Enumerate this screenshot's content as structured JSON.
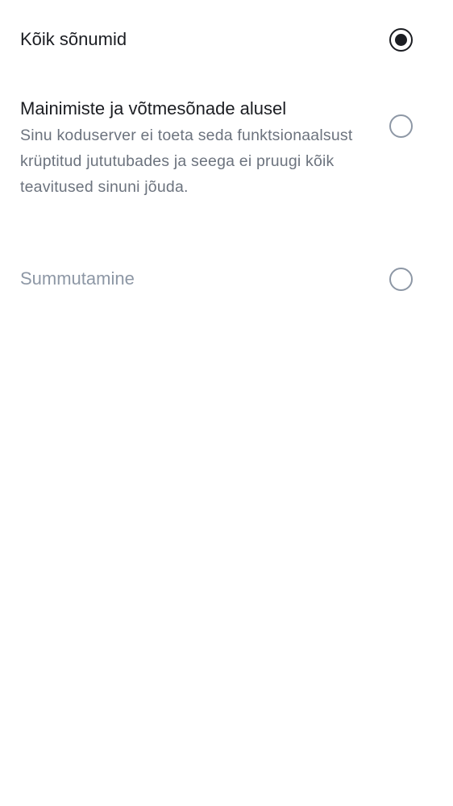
{
  "notification_options": {
    "all_messages": {
      "label": "Kõik sõnumid",
      "selected": true
    },
    "mentions_keywords": {
      "label": "Mainimiste ja võtmesõnade alusel",
      "description": "Sinu koduserver ei toeta seda funktsionaalsust krüptitud jututubades ja seega ei pruugi kõik teavitused sinuni jõuda.",
      "selected": false
    },
    "mute": {
      "label": "Summutamine",
      "selected": false,
      "disabled": true
    }
  },
  "colors": {
    "text_primary": "#1b1d22",
    "text_secondary": "#6c737e",
    "text_disabled": "#8d97a5",
    "radio_unselected": "#8d97a5"
  }
}
